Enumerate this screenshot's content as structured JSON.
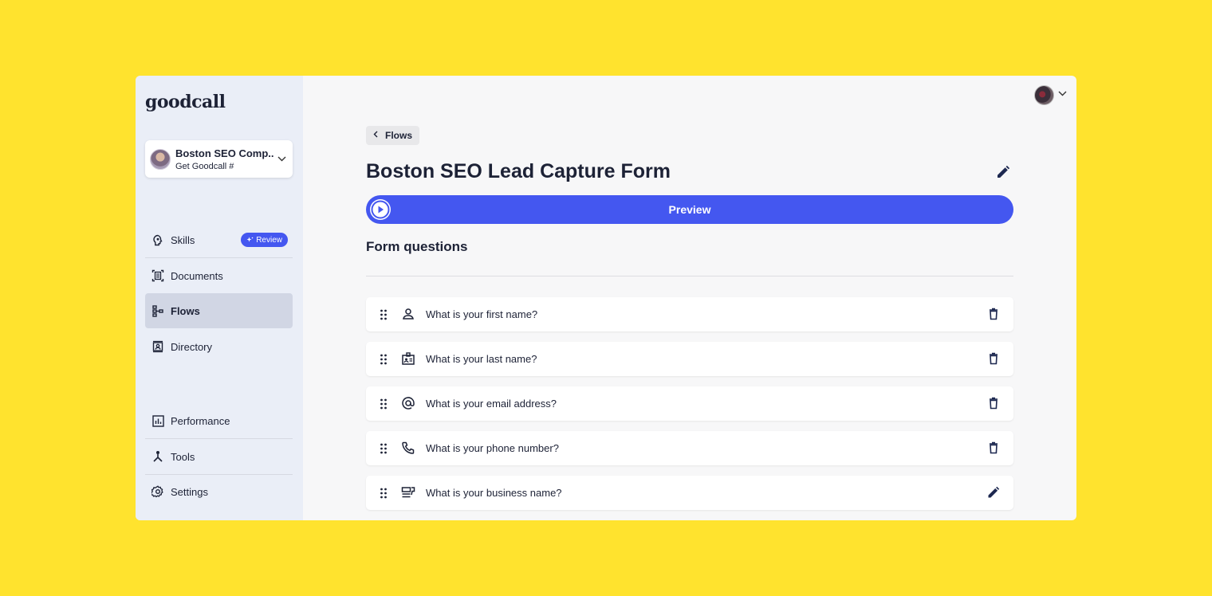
{
  "brand": {
    "logo_text": "goodcall",
    "accent": "#4457f0",
    "background": "#FFE32E"
  },
  "account": {
    "name": "Boston SEO Comp...",
    "subtitle": "Get Goodcall #",
    "chevron_icon": "chevron-down-icon"
  },
  "sidebar": {
    "items": [
      {
        "label": "Skills",
        "icon": "lightbulb-head-icon",
        "badge": "Review"
      },
      {
        "label": "Documents",
        "icon": "document-icon"
      },
      {
        "label": "Flows",
        "icon": "flow-icon",
        "active": true
      },
      {
        "label": "Directory",
        "icon": "contact-book-icon"
      },
      {
        "label": "Performance",
        "icon": "bar-chart-icon"
      },
      {
        "label": "Tools",
        "icon": "tools-icon"
      },
      {
        "label": "Settings",
        "icon": "gear-icon"
      }
    ]
  },
  "header": {
    "back_label": "Flows",
    "title": "Boston SEO Lead Capture Form"
  },
  "preview": {
    "label": "Preview"
  },
  "form": {
    "section_title": "Form questions",
    "questions": [
      {
        "text": "What is your first name?",
        "icon": "person-icon",
        "action": "delete"
      },
      {
        "text": "What is your last name?",
        "icon": "id-badge-icon",
        "action": "delete"
      },
      {
        "text": "What is your email address?",
        "icon": "at-sign-icon",
        "action": "delete"
      },
      {
        "text": "What is your phone number?",
        "icon": "phone-icon",
        "action": "delete"
      },
      {
        "text": "What is your business name?",
        "icon": "business-card-icon",
        "action": "edit"
      }
    ]
  }
}
